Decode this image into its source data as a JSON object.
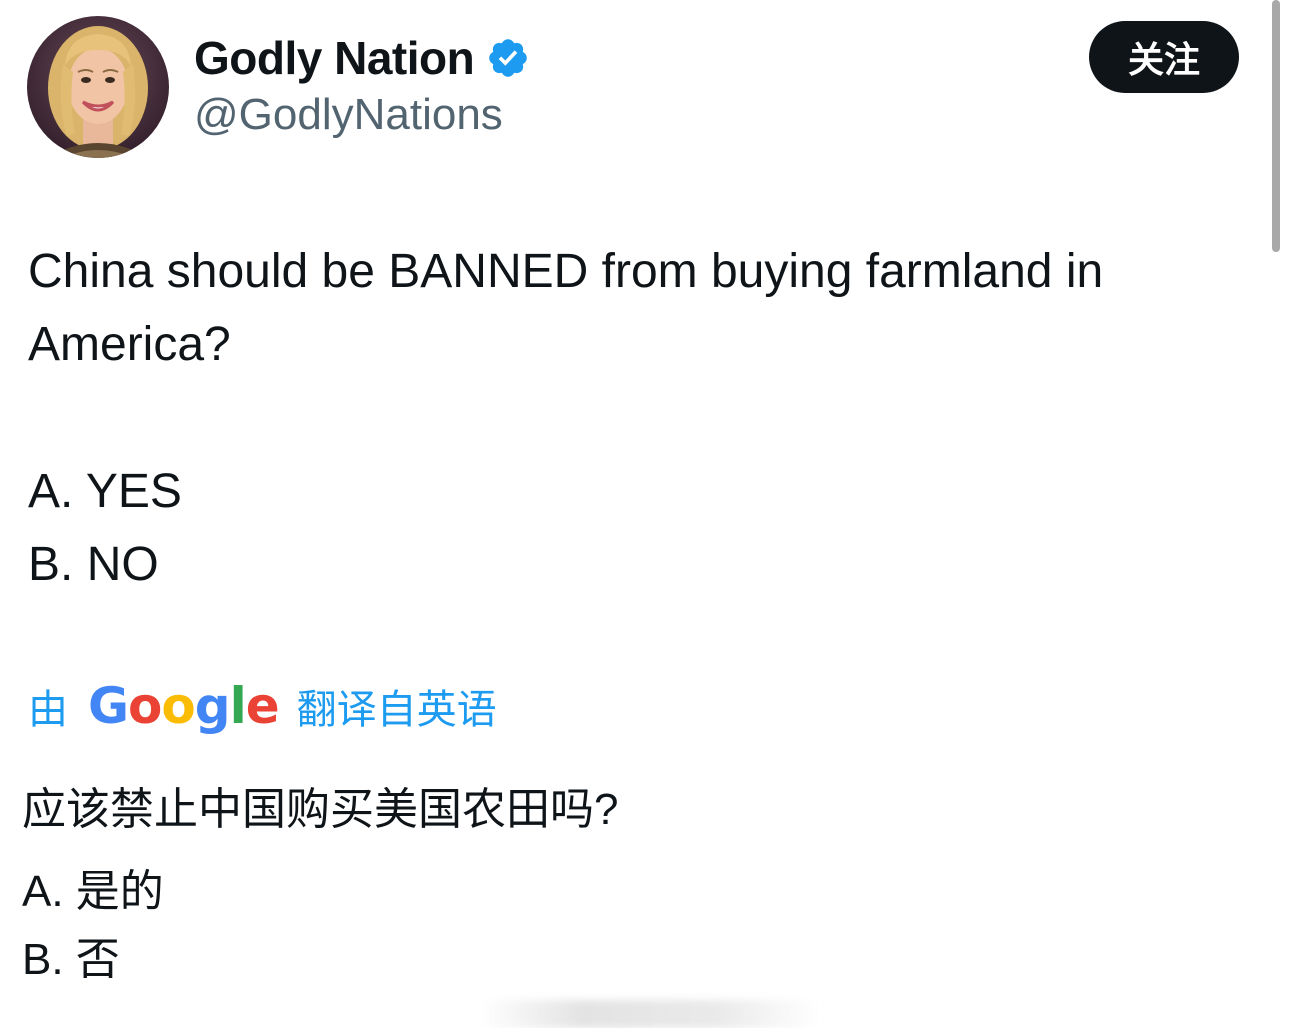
{
  "author": {
    "display_name": "Godly Nation",
    "handle": "@GodlyNations",
    "verified": true
  },
  "follow_button": {
    "label": "关注"
  },
  "tweet": {
    "lines": [
      "China should be BANNED from buying farmland in",
      "America?",
      "A. YES",
      "B. NO"
    ]
  },
  "translation": {
    "prefix": "由",
    "provider": "Google",
    "suffix": "翻译自英语",
    "lines": [
      "应该禁止中国购买美国农田吗?",
      "A. 是的",
      "B. 否"
    ]
  },
  "colors": {
    "link_blue": "#1d9bf0",
    "verified_blue": "#1d9bf0",
    "handle_gray": "#536471",
    "button_black": "#0f1419"
  },
  "icons": {
    "verified": "verified-badge-icon",
    "avatar": "profile-photo"
  }
}
